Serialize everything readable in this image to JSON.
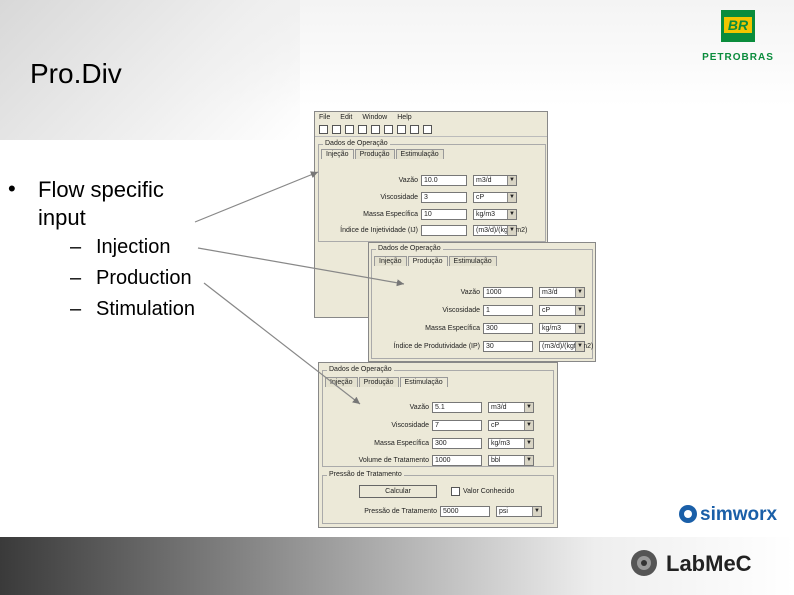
{
  "slide": {
    "title": "Pro.Div",
    "bullet": "Flow specific input",
    "subitems": [
      "Injection",
      "Production",
      "Stimulation"
    ]
  },
  "win1": {
    "menu": [
      "File",
      "Edit",
      "Window",
      "Help"
    ],
    "group_title": "Dados de Operação",
    "tabs": [
      "Injeção",
      "Produção",
      "Estimulação"
    ],
    "rows": [
      {
        "label": "Vazão",
        "value": "10.0",
        "unit": "m3/d"
      },
      {
        "label": "Viscosidade",
        "value": "3",
        "unit": "cP"
      },
      {
        "label": "Massa Específica",
        "value": "10",
        "unit": "kg/m3"
      },
      {
        "label": "Índice de Injetividade (IJ)",
        "value": "",
        "unit": "(m3/d)/(kgf/cm2)"
      }
    ]
  },
  "win2": {
    "group_title": "Dados de Operação",
    "tabs": [
      "Injeção",
      "Produção",
      "Estimulação"
    ],
    "rows": [
      {
        "label": "Vazão",
        "value": "1000",
        "unit": "m3/d"
      },
      {
        "label": "Viscosidade",
        "value": "1",
        "unit": "cP"
      },
      {
        "label": "Massa Específica",
        "value": "300",
        "unit": "kg/m3"
      },
      {
        "label": "Índice de Produtividade (IP)",
        "value": "30",
        "unit": "(m3/d)/(kgf/cm2)"
      }
    ]
  },
  "win3": {
    "group_title": "Dados de Operação",
    "tabs": [
      "Injeção",
      "Produção",
      "Estimulação"
    ],
    "rows": [
      {
        "label": "Vazão",
        "value": "5.1",
        "unit": "m3/d"
      },
      {
        "label": "Viscosidade",
        "value": "7",
        "unit": "cP"
      },
      {
        "label": "Massa Específica",
        "value": "300",
        "unit": "kg/m3"
      },
      {
        "label": "Volume de Tratamento",
        "value": "1000",
        "unit": "bbl"
      }
    ],
    "pressure_group_title": "Pressão de Tratamento",
    "calc_button": "Calcular",
    "checkbox_label": "Valor Conhecido",
    "pressure_label": "Pressão de Tratamento",
    "pressure_value": "5000",
    "pressure_unit": "psi"
  },
  "logos": {
    "petrobras_badge": "BR",
    "petrobras": "PETROBRAS",
    "simworx": "simworx",
    "labmec": "LabMeC"
  },
  "colors": {
    "petrobras_green": "#0a8c3c",
    "petrobras_yellow": "#f2c500",
    "simworx_blue": "#1a5fa8"
  }
}
